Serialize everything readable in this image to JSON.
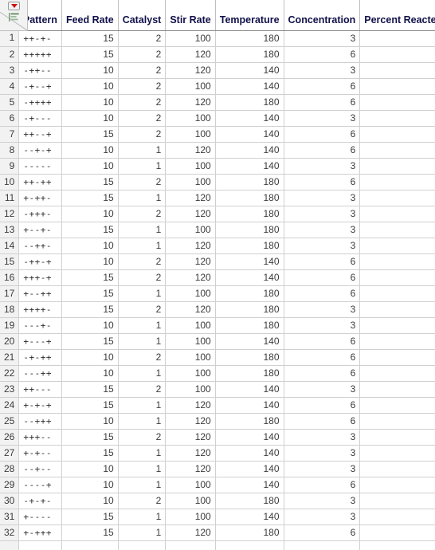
{
  "corner": {
    "menu_icon": "red-triangle-dropdown-icon",
    "rows_icon": "row-states-icon"
  },
  "table": {
    "columns": [
      {
        "key": "rownum",
        "label": "",
        "align": "right"
      },
      {
        "key": "pattern",
        "label": "Pattern",
        "align": "left"
      },
      {
        "key": "feed_rate",
        "label": "Feed Rate",
        "align": "right"
      },
      {
        "key": "catalyst",
        "label": "Catalyst",
        "align": "right"
      },
      {
        "key": "stir_rate",
        "label": "Stir Rate",
        "align": "right"
      },
      {
        "key": "temperature",
        "label": "Temperature",
        "align": "right"
      },
      {
        "key": "concentration",
        "label": "Concentration",
        "align": "right"
      },
      {
        "key": "percent_reacted",
        "label": "Percent Reacted",
        "align": "right"
      }
    ],
    "missing_marker": "•",
    "rows": [
      {
        "rownum": "1",
        "pattern": "++-+-",
        "feed_rate": "15",
        "catalyst": "2",
        "stir_rate": "100",
        "temperature": "180",
        "concentration": "3",
        "percent_reacted": ""
      },
      {
        "rownum": "2",
        "pattern": "+++++",
        "feed_rate": "15",
        "catalyst": "2",
        "stir_rate": "120",
        "temperature": "180",
        "concentration": "6",
        "percent_reacted": ""
      },
      {
        "rownum": "3",
        "pattern": "-++--",
        "feed_rate": "10",
        "catalyst": "2",
        "stir_rate": "120",
        "temperature": "140",
        "concentration": "3",
        "percent_reacted": ""
      },
      {
        "rownum": "4",
        "pattern": "-+--+",
        "feed_rate": "10",
        "catalyst": "2",
        "stir_rate": "100",
        "temperature": "140",
        "concentration": "6",
        "percent_reacted": ""
      },
      {
        "rownum": "5",
        "pattern": "-++++",
        "feed_rate": "10",
        "catalyst": "2",
        "stir_rate": "120",
        "temperature": "180",
        "concentration": "6",
        "percent_reacted": ""
      },
      {
        "rownum": "6",
        "pattern": "-+---",
        "feed_rate": "10",
        "catalyst": "2",
        "stir_rate": "100",
        "temperature": "140",
        "concentration": "3",
        "percent_reacted": ""
      },
      {
        "rownum": "7",
        "pattern": "++--+",
        "feed_rate": "15",
        "catalyst": "2",
        "stir_rate": "100",
        "temperature": "140",
        "concentration": "6",
        "percent_reacted": ""
      },
      {
        "rownum": "8",
        "pattern": "--+-+",
        "feed_rate": "10",
        "catalyst": "1",
        "stir_rate": "120",
        "temperature": "140",
        "concentration": "6",
        "percent_reacted": ""
      },
      {
        "rownum": "9",
        "pattern": "-----",
        "feed_rate": "10",
        "catalyst": "1",
        "stir_rate": "100",
        "temperature": "140",
        "concentration": "3",
        "percent_reacted": ""
      },
      {
        "rownum": "10",
        "pattern": "++-++",
        "feed_rate": "15",
        "catalyst": "2",
        "stir_rate": "100",
        "temperature": "180",
        "concentration": "6",
        "percent_reacted": ""
      },
      {
        "rownum": "11",
        "pattern": "+-++-",
        "feed_rate": "15",
        "catalyst": "1",
        "stir_rate": "120",
        "temperature": "180",
        "concentration": "3",
        "percent_reacted": ""
      },
      {
        "rownum": "12",
        "pattern": "-+++-",
        "feed_rate": "10",
        "catalyst": "2",
        "stir_rate": "120",
        "temperature": "180",
        "concentration": "3",
        "percent_reacted": ""
      },
      {
        "rownum": "13",
        "pattern": "+--+-",
        "feed_rate": "15",
        "catalyst": "1",
        "stir_rate": "100",
        "temperature": "180",
        "concentration": "3",
        "percent_reacted": ""
      },
      {
        "rownum": "14",
        "pattern": "--++-",
        "feed_rate": "10",
        "catalyst": "1",
        "stir_rate": "120",
        "temperature": "180",
        "concentration": "3",
        "percent_reacted": ""
      },
      {
        "rownum": "15",
        "pattern": "-++-+",
        "feed_rate": "10",
        "catalyst": "2",
        "stir_rate": "120",
        "temperature": "140",
        "concentration": "6",
        "percent_reacted": ""
      },
      {
        "rownum": "16",
        "pattern": "+++-+",
        "feed_rate": "15",
        "catalyst": "2",
        "stir_rate": "120",
        "temperature": "140",
        "concentration": "6",
        "percent_reacted": ""
      },
      {
        "rownum": "17",
        "pattern": "+--++",
        "feed_rate": "15",
        "catalyst": "1",
        "stir_rate": "100",
        "temperature": "180",
        "concentration": "6",
        "percent_reacted": ""
      },
      {
        "rownum": "18",
        "pattern": "++++-",
        "feed_rate": "15",
        "catalyst": "2",
        "stir_rate": "120",
        "temperature": "180",
        "concentration": "3",
        "percent_reacted": ""
      },
      {
        "rownum": "19",
        "pattern": "---+-",
        "feed_rate": "10",
        "catalyst": "1",
        "stir_rate": "100",
        "temperature": "180",
        "concentration": "3",
        "percent_reacted": ""
      },
      {
        "rownum": "20",
        "pattern": "+---+",
        "feed_rate": "15",
        "catalyst": "1",
        "stir_rate": "100",
        "temperature": "140",
        "concentration": "6",
        "percent_reacted": ""
      },
      {
        "rownum": "21",
        "pattern": "-+-++",
        "feed_rate": "10",
        "catalyst": "2",
        "stir_rate": "100",
        "temperature": "180",
        "concentration": "6",
        "percent_reacted": ""
      },
      {
        "rownum": "22",
        "pattern": "---++",
        "feed_rate": "10",
        "catalyst": "1",
        "stir_rate": "100",
        "temperature": "180",
        "concentration": "6",
        "percent_reacted": ""
      },
      {
        "rownum": "23",
        "pattern": "++---",
        "feed_rate": "15",
        "catalyst": "2",
        "stir_rate": "100",
        "temperature": "140",
        "concentration": "3",
        "percent_reacted": ""
      },
      {
        "rownum": "24",
        "pattern": "+-+-+",
        "feed_rate": "15",
        "catalyst": "1",
        "stir_rate": "120",
        "temperature": "140",
        "concentration": "6",
        "percent_reacted": ""
      },
      {
        "rownum": "25",
        "pattern": "--+++",
        "feed_rate": "10",
        "catalyst": "1",
        "stir_rate": "120",
        "temperature": "180",
        "concentration": "6",
        "percent_reacted": ""
      },
      {
        "rownum": "26",
        "pattern": "+++--",
        "feed_rate": "15",
        "catalyst": "2",
        "stir_rate": "120",
        "temperature": "140",
        "concentration": "3",
        "percent_reacted": ""
      },
      {
        "rownum": "27",
        "pattern": "+-+--",
        "feed_rate": "15",
        "catalyst": "1",
        "stir_rate": "120",
        "temperature": "140",
        "concentration": "3",
        "percent_reacted": ""
      },
      {
        "rownum": "28",
        "pattern": "--+--",
        "feed_rate": "10",
        "catalyst": "1",
        "stir_rate": "120",
        "temperature": "140",
        "concentration": "3",
        "percent_reacted": ""
      },
      {
        "rownum": "29",
        "pattern": "----+",
        "feed_rate": "10",
        "catalyst": "1",
        "stir_rate": "100",
        "temperature": "140",
        "concentration": "6",
        "percent_reacted": ""
      },
      {
        "rownum": "30",
        "pattern": "-+-+-",
        "feed_rate": "10",
        "catalyst": "2",
        "stir_rate": "100",
        "temperature": "180",
        "concentration": "3",
        "percent_reacted": ""
      },
      {
        "rownum": "31",
        "pattern": "+----",
        "feed_rate": "15",
        "catalyst": "1",
        "stir_rate": "100",
        "temperature": "140",
        "concentration": "3",
        "percent_reacted": ""
      },
      {
        "rownum": "32",
        "pattern": "+-+++",
        "feed_rate": "15",
        "catalyst": "1",
        "stir_rate": "120",
        "temperature": "180",
        "concentration": "6",
        "percent_reacted": ""
      }
    ]
  },
  "colors": {
    "header_text": "#10104a",
    "gutter_bg": "#f2f2f2",
    "grid_line": "#d0d0d0",
    "menu_triangle": "#d01010"
  }
}
